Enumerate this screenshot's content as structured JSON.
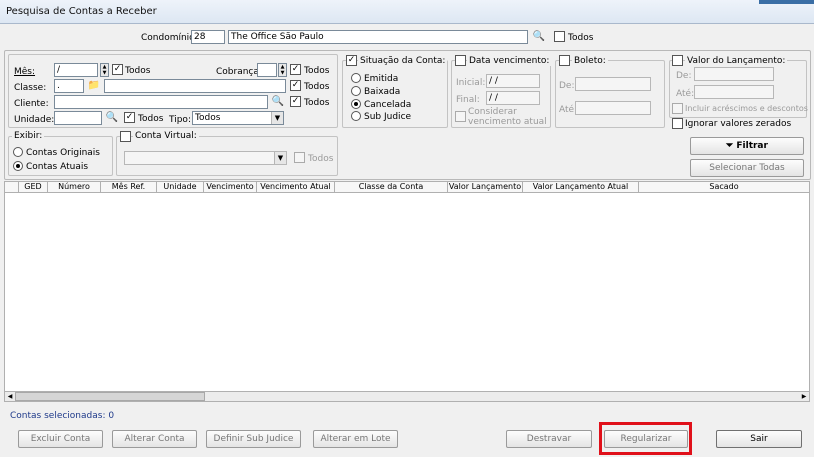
{
  "window": {
    "title": "Pesquisa de Contas a Receber"
  },
  "condominio": {
    "label": "Condomínio:",
    "code": "28",
    "name": "The Office São Paulo",
    "todos_label": "Todos"
  },
  "filters": {
    "mes": {
      "label": "Mês:",
      "value": "  /",
      "todos_label": "Todos",
      "todos_checked": true
    },
    "cobranca": {
      "label": "Cobrança:",
      "value": "",
      "todos_label": "Todos",
      "todos_checked": true
    },
    "classe": {
      "label": "Classe:",
      "value": ".",
      "todos_label": "Todos",
      "todos_checked": true
    },
    "cliente": {
      "label": "Cliente:",
      "value": "",
      "todos_label": "Todos",
      "todos_checked": true
    },
    "unidade": {
      "label": "Unidade:",
      "value": "",
      "todos_label": "Todos",
      "todos_checked": true
    },
    "tipo": {
      "label": "Tipo:",
      "selected": "Todos"
    }
  },
  "situacao": {
    "title": "Situação da Conta:",
    "checked": true,
    "options": [
      "Emitida",
      "Baixada",
      "Cancelada",
      "Sub Judice"
    ],
    "selected": "Cancelada"
  },
  "data_vencimento": {
    "title": "Data vencimento:",
    "inicial_label": "Inicial:",
    "inicial_value": " / /",
    "final_label": "Final:",
    "final_value": " / /",
    "considerar_label_1": "Considerar",
    "considerar_label_2": "vencimento atual"
  },
  "boleto": {
    "title": "Boleto:",
    "de_label": "De:",
    "ate_label": "Até:"
  },
  "valor": {
    "title": "Valor do Lançamento:",
    "de_label": "De:",
    "ate_label": "Até:",
    "incluir_label": "Incluir acréscimos e descontos",
    "ignorar_label": "Ignorar valores zerados"
  },
  "exibir": {
    "title": "Exibir:",
    "options": [
      "Contas Originais",
      "Contas Atuais"
    ],
    "selected": "Contas Atuais"
  },
  "conta_virtual": {
    "title": "Conta Virtual:",
    "todos_label": "Todos"
  },
  "buttons": {
    "filtrar": "Filtrar",
    "selecionar_todas": "Selecionar Todas",
    "excluir": "Excluir Conta",
    "alterar": "Alterar Conta",
    "definir_sub_judice": "Definir Sub Judice",
    "alterar_lote": "Alterar em Lote",
    "destravar": "Destravar",
    "regularizar": "Regularizar",
    "sair": "Sair"
  },
  "grid": {
    "columns": [
      "GED",
      "Número",
      "Mês Ref.",
      "Unidade",
      "Vencimento",
      "Vencimento Atual",
      "Classe da Conta",
      "Valor Lançamento",
      "Valor Lançamento Atual",
      "Sacado"
    ]
  },
  "status": {
    "text": "Contas selecionadas: 0"
  },
  "icons": {
    "binoculars": "binoculars-icon",
    "folder": "folder-icon",
    "filter": "funnel-icon"
  }
}
